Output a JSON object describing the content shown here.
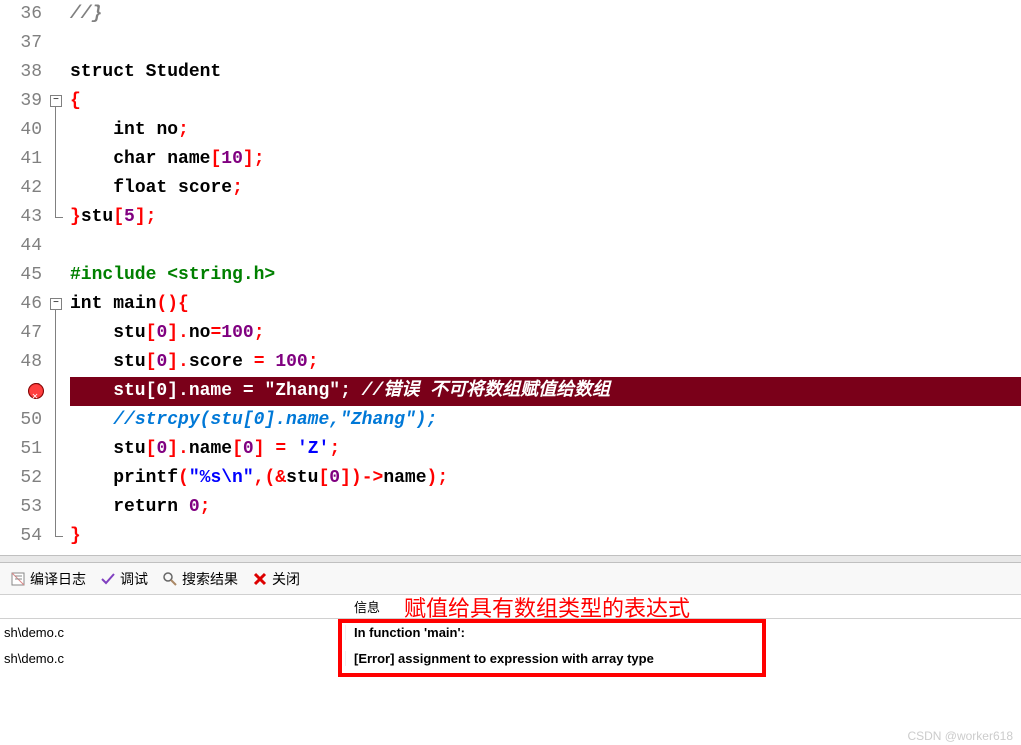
{
  "code": {
    "lines": [
      {
        "num": "36",
        "html": "<span class='comment-gray2'>//}</span>"
      },
      {
        "num": "37",
        "html": ""
      },
      {
        "num": "38",
        "html": "<span class='kw'>struct</span> <span class='ident'>Student</span>"
      },
      {
        "num": "39",
        "html": "<span class='punc'>{</span>",
        "fold": true
      },
      {
        "num": "40",
        "html": "    <span class='kw'>int</span> <span class='ident'>no</span><span class='punc'>;</span>"
      },
      {
        "num": "41",
        "html": "    <span class='kw'>char</span> <span class='ident'>name</span><span class='punc'>[</span><span class='num'>10</span><span class='punc'>];</span>"
      },
      {
        "num": "42",
        "html": "    <span class='kw'>float</span> <span class='ident'>score</span><span class='punc'>;</span>"
      },
      {
        "num": "43",
        "html": "<span class='punc'>}</span><span class='ident'>stu</span><span class='punc'>[</span><span class='num'>5</span><span class='punc'>];</span>",
        "foldend": true
      },
      {
        "num": "44",
        "html": ""
      },
      {
        "num": "45",
        "html": "<span class='preproc'>#include &lt;string.h&gt;</span>"
      },
      {
        "num": "46",
        "html": "<span class='kw'>int</span> <span class='ident'>main</span><span class='punc'>(){</span>",
        "fold": true
      },
      {
        "num": "47",
        "html": "    <span class='ident'>stu</span><span class='punc'>[</span><span class='num'>0</span><span class='punc'>].</span><span class='ident'>no</span><span class='punc'>=</span><span class='num'>100</span><span class='punc'>;</span>"
      },
      {
        "num": "48",
        "html": "    <span class='ident'>stu</span><span class='punc'>[</span><span class='num'>0</span><span class='punc'>].</span><span class='ident'>score</span> <span class='punc'>=</span> <span class='num'>100</span><span class='punc'>;</span>"
      },
      {
        "num": "49",
        "error": true,
        "highlight": true,
        "html": "    stu[0].name = <span class='str'>\"Zhang\"</span>; <span class='comment-italic'>//错误 不可将数组赋值给数组</span>"
      },
      {
        "num": "50",
        "html": "    <span class='comment-gray'>//strcpy(stu[0].name,\"Zhang\");</span>"
      },
      {
        "num": "51",
        "html": "    <span class='ident'>stu</span><span class='punc'>[</span><span class='num'>0</span><span class='punc'>].</span><span class='ident'>name</span><span class='punc'>[</span><span class='num'>0</span><span class='punc'>]</span> <span class='punc'>=</span> <span class='str'>'Z'</span><span class='punc'>;</span>"
      },
      {
        "num": "52",
        "html": "    <span class='ident'>printf</span><span class='punc'>(</span><span class='str'>\"%s\\n\"</span><span class='punc'>,(&amp;</span><span class='ident'>stu</span><span class='punc'>[</span><span class='num'>0</span><span class='punc'>])-&gt;</span><span class='ident'>name</span><span class='punc'>);</span>"
      },
      {
        "num": "53",
        "html": "    <span class='kw'>return</span> <span class='num'>0</span><span class='punc'>;</span>"
      },
      {
        "num": "54",
        "html": "<span class='punc'>}</span>"
      }
    ]
  },
  "toolbar": {
    "compile_log": "编译日志",
    "debug": "调试",
    "search": "搜索结果",
    "close": "关闭"
  },
  "results": {
    "header_col2": "信息",
    "annotation": "赋值给具有数组类型的表达式",
    "rows": [
      {
        "path": "sh\\demo.c",
        "msg": "In function 'main':"
      },
      {
        "path": "sh\\demo.c",
        "msg": "[Error] assignment to expression with array type"
      }
    ]
  },
  "watermark": "CSDN @worker618"
}
